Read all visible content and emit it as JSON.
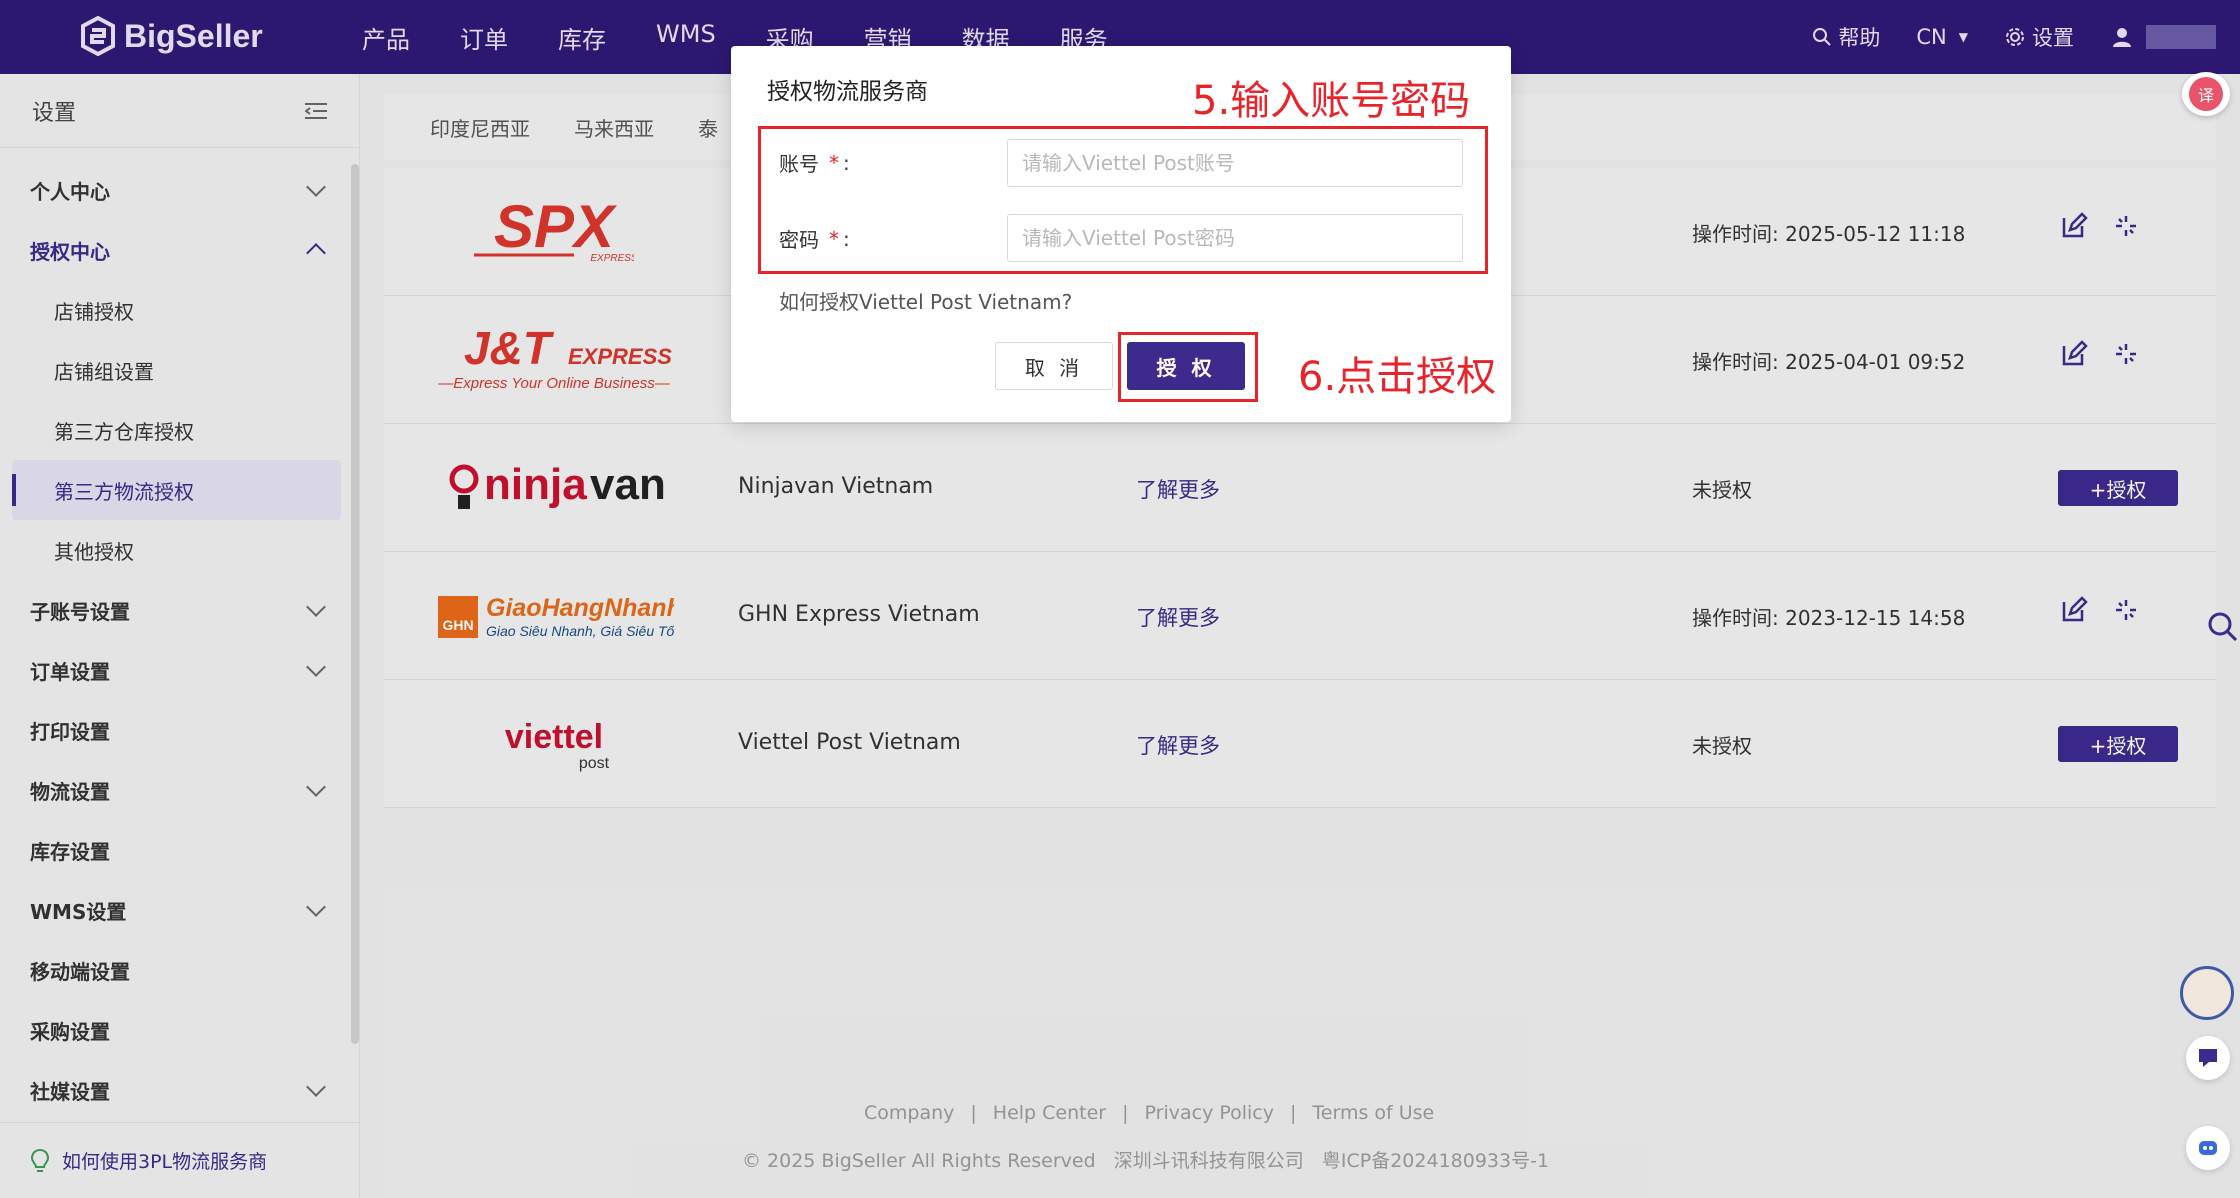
{
  "app": {
    "logo_text": "BigSeller",
    "nav": [
      "产品",
      "订单",
      "库存",
      "WMS",
      "采购",
      "营销",
      "数据",
      "服务"
    ],
    "help_label": "帮助",
    "lang_label": "CN",
    "settings_label": "设置"
  },
  "sidebar": {
    "title": "设置",
    "items": [
      {
        "label": "个人中心",
        "type": "parent"
      },
      {
        "label": "授权中心",
        "type": "parent-open"
      },
      {
        "label": "店铺授权",
        "type": "sub"
      },
      {
        "label": "店铺组设置",
        "type": "sub"
      },
      {
        "label": "第三方仓库授权",
        "type": "sub"
      },
      {
        "label": "第三方物流授权",
        "type": "sub-active"
      },
      {
        "label": "其他授权",
        "type": "sub"
      },
      {
        "label": "子账号设置",
        "type": "parent"
      },
      {
        "label": "订单设置",
        "type": "parent"
      },
      {
        "label": "打印设置",
        "type": "plain"
      },
      {
        "label": "物流设置",
        "type": "parent"
      },
      {
        "label": "库存设置",
        "type": "plain"
      },
      {
        "label": "WMS设置",
        "type": "parent"
      },
      {
        "label": "移动端设置",
        "type": "plain"
      },
      {
        "label": "采购设置",
        "type": "plain"
      },
      {
        "label": "社媒设置",
        "type": "parent"
      }
    ],
    "footer_link": "如何使用3PL物流服务商"
  },
  "tabs": [
    "印度尼西亚",
    "马来西亚",
    "泰"
  ],
  "rows": [
    {
      "logo": "SPX",
      "name": "",
      "learn": "",
      "op_label": "操作时间:",
      "op_time": "2025-05-12 11:18",
      "authorized": true
    },
    {
      "logo": "J&T EXPRESS",
      "name": "",
      "learn": "",
      "op_label": "操作时间:",
      "op_time": "2025-04-01 09:52",
      "authorized": true
    },
    {
      "logo": "ninjavan",
      "name": "Ninjavan Vietnam",
      "learn": "了解更多",
      "op_label": "未授权",
      "op_time": "",
      "authorized": false
    },
    {
      "logo": "GiaoHangNhanh",
      "name": "GHN Express Vietnam",
      "learn": "了解更多",
      "op_label": "操作时间:",
      "op_time": "2023-12-15 14:58",
      "authorized": true
    },
    {
      "logo": "viettel post",
      "name": "Viettel Post Vietnam",
      "learn": "了解更多",
      "op_label": "未授权",
      "op_time": "",
      "authorized": false
    }
  ],
  "authorize_button": "+授权",
  "footer": {
    "links": [
      "Company",
      "Help Center",
      "Privacy Policy",
      "Terms of Use"
    ],
    "copyright": "© 2025 BigSeller All Rights Reserved   深圳斗讯科技有限公司   粤ICP备2024180933号-1"
  },
  "modal": {
    "title": "授权物流服务商",
    "account_label": "账号",
    "account_placeholder": "请输入Viettel Post账号",
    "password_label": "密码",
    "password_placeholder": "请输入Viettel Post密码",
    "help_link": "如何授权Viettel Post Vietnam?",
    "cancel": "取 消",
    "confirm": "授 权"
  },
  "annotations": {
    "step5": "5.输入账号密码",
    "step6": "6.点击授权"
  },
  "colors": {
    "brand": "#2e1a76",
    "accent": "#3c2a8d",
    "annotation": "#e8242b"
  }
}
